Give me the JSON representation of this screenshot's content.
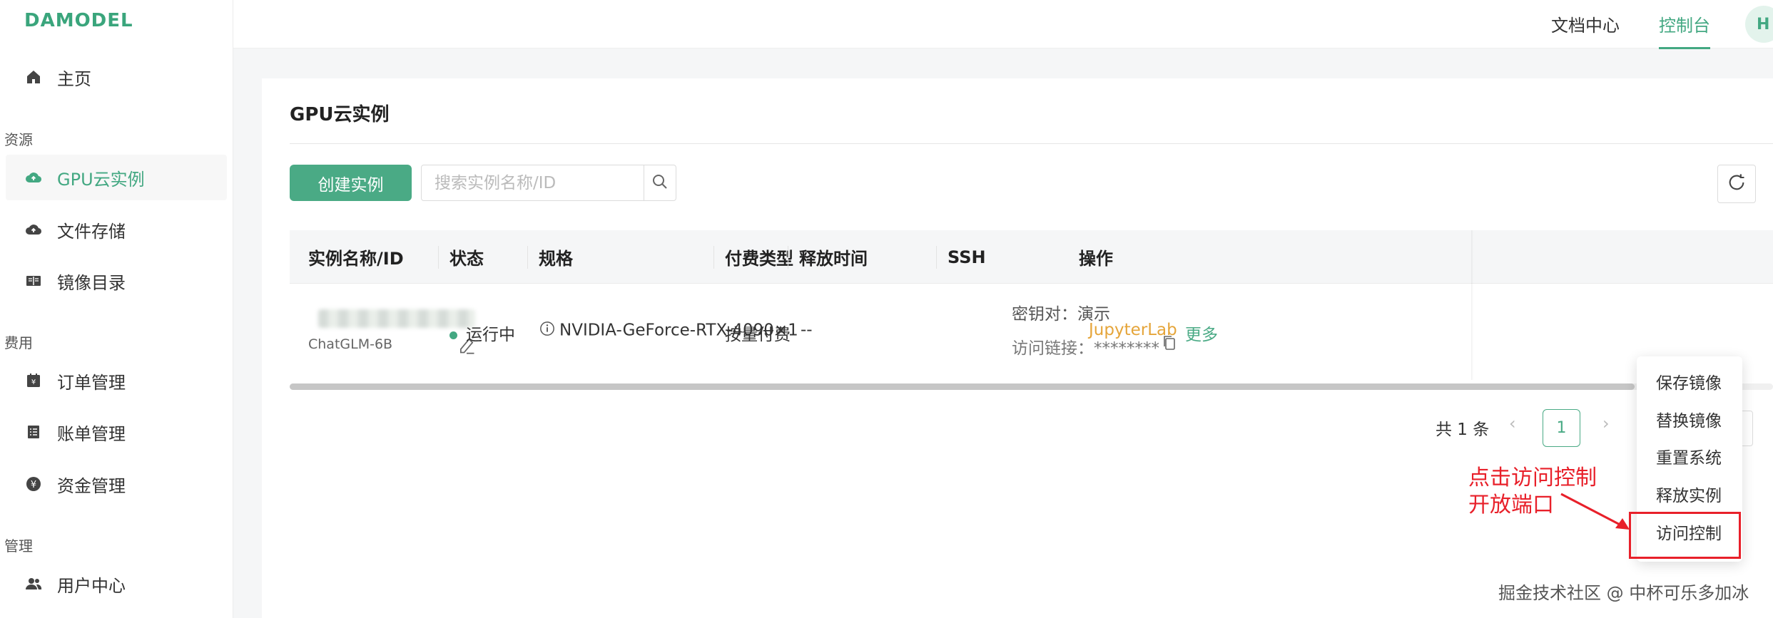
{
  "brand": {
    "logo": "DAMODEL"
  },
  "sidebar": {
    "home": "主页",
    "groups": [
      "资源",
      "费用",
      "管理"
    ],
    "items": [
      {
        "label": "GPU云实例",
        "icon": "cloud-gpu-icon"
      },
      {
        "label": "文件存储",
        "icon": "cloud-upload-icon"
      },
      {
        "label": "镜像目录",
        "icon": "book-icon"
      },
      {
        "label": "订单管理",
        "icon": "order-icon"
      },
      {
        "label": "账单管理",
        "icon": "list-icon"
      },
      {
        "label": "资金管理",
        "icon": "yen-icon"
      },
      {
        "label": "用户中心",
        "icon": "users-icon"
      }
    ]
  },
  "header": {
    "docs": "文档中心",
    "console": "控制台",
    "avatar": "H"
  },
  "page": {
    "title": "GPU云实例",
    "create_button": "创建实例",
    "search_placeholder": "搜索实例名称/ID"
  },
  "table": {
    "columns": [
      "实例名称/ID",
      "状态",
      "规格",
      "付费类型",
      "释放时间",
      "SSH",
      "操作"
    ],
    "row": {
      "name": "ChatGLM-6B",
      "status": "运行中",
      "spec": "NVIDIA-GeForce-RTX-4090×1",
      "billing": "按量付费",
      "release": "--",
      "ssh_keypair": "密钥对：演示",
      "ssh_link": "访问链接：********",
      "action_jupyter": "JupyterLab",
      "action_more": "更多"
    }
  },
  "pagination": {
    "total": "共 1 条",
    "current": "1"
  },
  "more_menu": [
    "保存镜像",
    "替换镜像",
    "重置系统",
    "释放实例",
    "访问控制"
  ],
  "annotation": {
    "line1": "点击访问控制",
    "line2": "开放端口"
  },
  "watermark": "掘金技术社区 @ 中杯可乐多加冰",
  "colors": {
    "accent": "#4aaa85",
    "jupyter": "#e5a53a",
    "annotation": "#e8202a"
  }
}
